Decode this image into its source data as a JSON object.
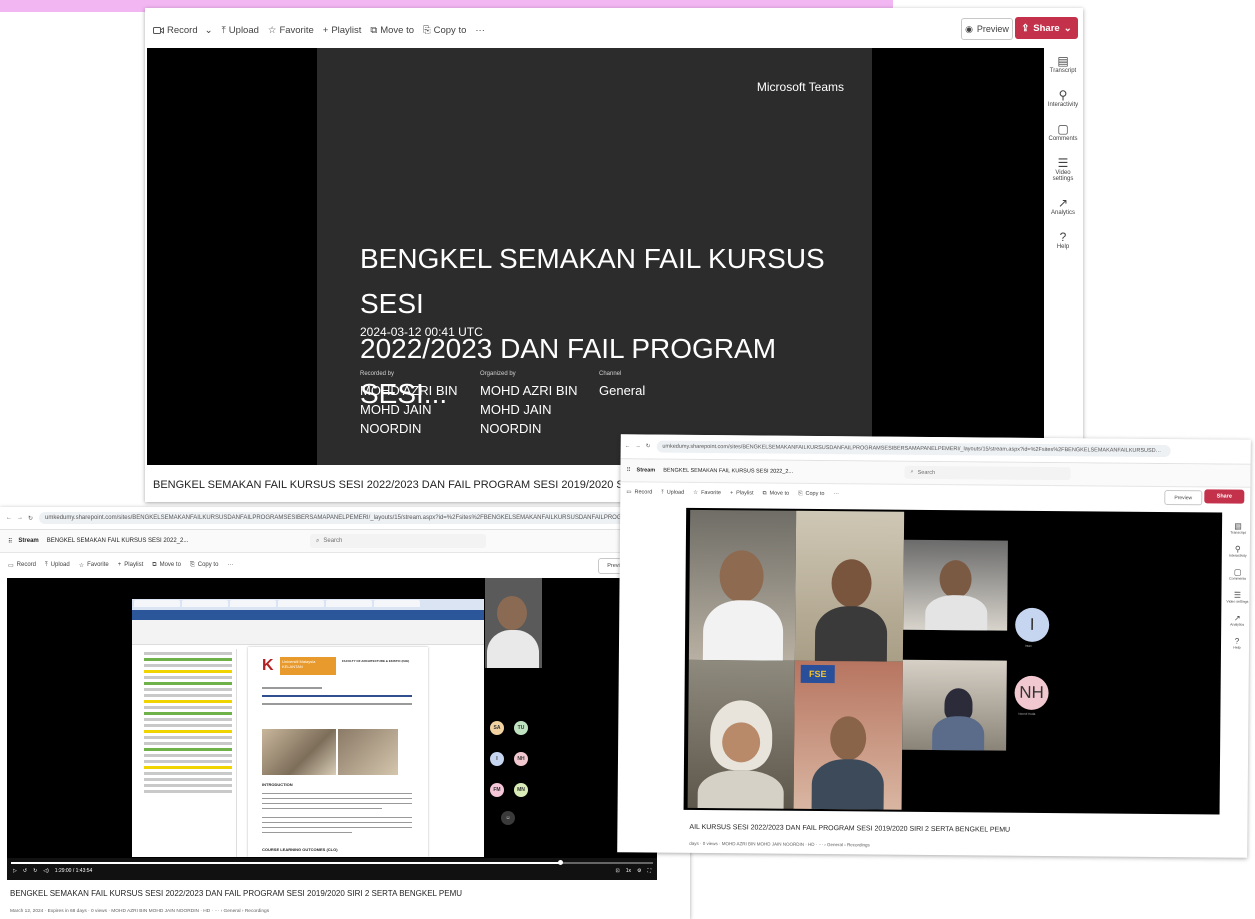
{
  "toolbar": {
    "record": "Record",
    "upload": "Upload",
    "favorite": "Favorite",
    "playlist": "Playlist",
    "move_to": "Move to",
    "copy_to": "Copy to",
    "more": "···",
    "preview": "Preview",
    "share": "Share"
  },
  "rail": {
    "transcript": "Transcript",
    "interactivity": "Interactivity",
    "comments": "Comments",
    "video_settings": "Video settings",
    "analytics": "Analytics",
    "help": "Help"
  },
  "slide": {
    "brand": "Microsoft Teams",
    "title_line1": "BENGKEL SEMAKAN FAIL KURSUS SESI",
    "title_line2": "2022/2023 DAN FAIL PROGRAM SESI...",
    "date": "2024-03-12 00:41 UTC",
    "recorded_by_label": "Recorded by",
    "recorded_by": "MOHD AZRI BIN MOHD JAIN NOORDIN",
    "organized_by_label": "Organized by",
    "organized_by": "MOHD AZRI BIN MOHD JAIN NOORDIN",
    "channel_label": "Channel",
    "channel": "General"
  },
  "window1": {
    "video_title": "BENGKEL SEMAKAN FAIL KURSUS SESI 2022/2023 DAN FAIL PROGRAM SESI 2019/2020 SIRI 2 SERTA BENGKEL PEMU"
  },
  "window2": {
    "url": "umkedumy.sharepoint.com/sites/BENGKELSEMAKANFAILKURSUSDANFAILPROGRAMSESIBERSAMAPANELPEMERI/_layouts/15/stream.aspx?id=%2Fsites%2FBENGKELSEMAKANFAILKURSUSDANFAILPROGRAMSESIBERSAMAPAN...",
    "app_name": "Stream",
    "breadcrumb": "BENGKEL SEMAKAN FAIL KURSUS SESI 2022_2...",
    "search_placeholder": "Search",
    "time": "1:29:00 / 1:43:54",
    "progress": 0.855,
    "video_title": "BENGKEL SEMAKAN FAIL KURSUS SESI 2022/2023 DAN FAIL PROGRAM SESI 2019/2020 SIRI 2 SERTA BENGKEL PEMU",
    "meta": "March 12, 2024 · Expires in 68 days · 0 views · MOHD AZRI BIN MOHD JAIN NOORDIN · HD · ··· › General › Recordings",
    "participants": [
      {
        "initials": "SA",
        "color": "#f3d2a2"
      },
      {
        "initials": "TU",
        "color": "#bfe3c0"
      },
      {
        "initials": "I",
        "color": "#c7d6f0"
      },
      {
        "initials": "NH",
        "color": "#f2c8d0"
      },
      {
        "initials": "FM",
        "color": "#f5c6d8"
      },
      {
        "initials": "MN",
        "color": "#d9ecb8"
      }
    ],
    "doc": {
      "university": "Universiti Malaysia KELANTAN",
      "faculty": "FACULTY OF ARCHITECTURE & EKISTIC (FAE)",
      "heading": "INTRODUCTION",
      "section": "COURSE LEARNING OUTCOMES (CLO)"
    }
  },
  "window3": {
    "url": "umkedumy.sharepoint.com/sites/BENGKELSEMAKANFAILKURSUSDANFAILPROGRAMSESIBERSAMAPANELPEMERI/_layouts/15/stream.aspx?id=%2Fsites%2FBENGKELSEMAKANFAILKURSUSDANFAILPROGRAMSESIBERSAMAPAN...",
    "app_name": "Stream",
    "breadcrumb": "BENGKEL SEMAKAN FAIL KURSUS SESI 2022_2...",
    "search_placeholder": "Search",
    "video_title": "AIL KURSUS SESI 2022/2023 DAN FAIL PROGRAM SESI 2019/2020 SIRI 2 SERTA BENGKEL PEMU",
    "meta": "days · 0 views · MOHD AZRI BIN MOHD JAIN NOORDIN · HD · ··· › General › Recordings",
    "avatar_i": "I",
    "avatar_nh": "NH",
    "avatar_nh_label": "Noorul Huda",
    "avatar_i_label": "Intan",
    "logo_text": "FSE"
  }
}
